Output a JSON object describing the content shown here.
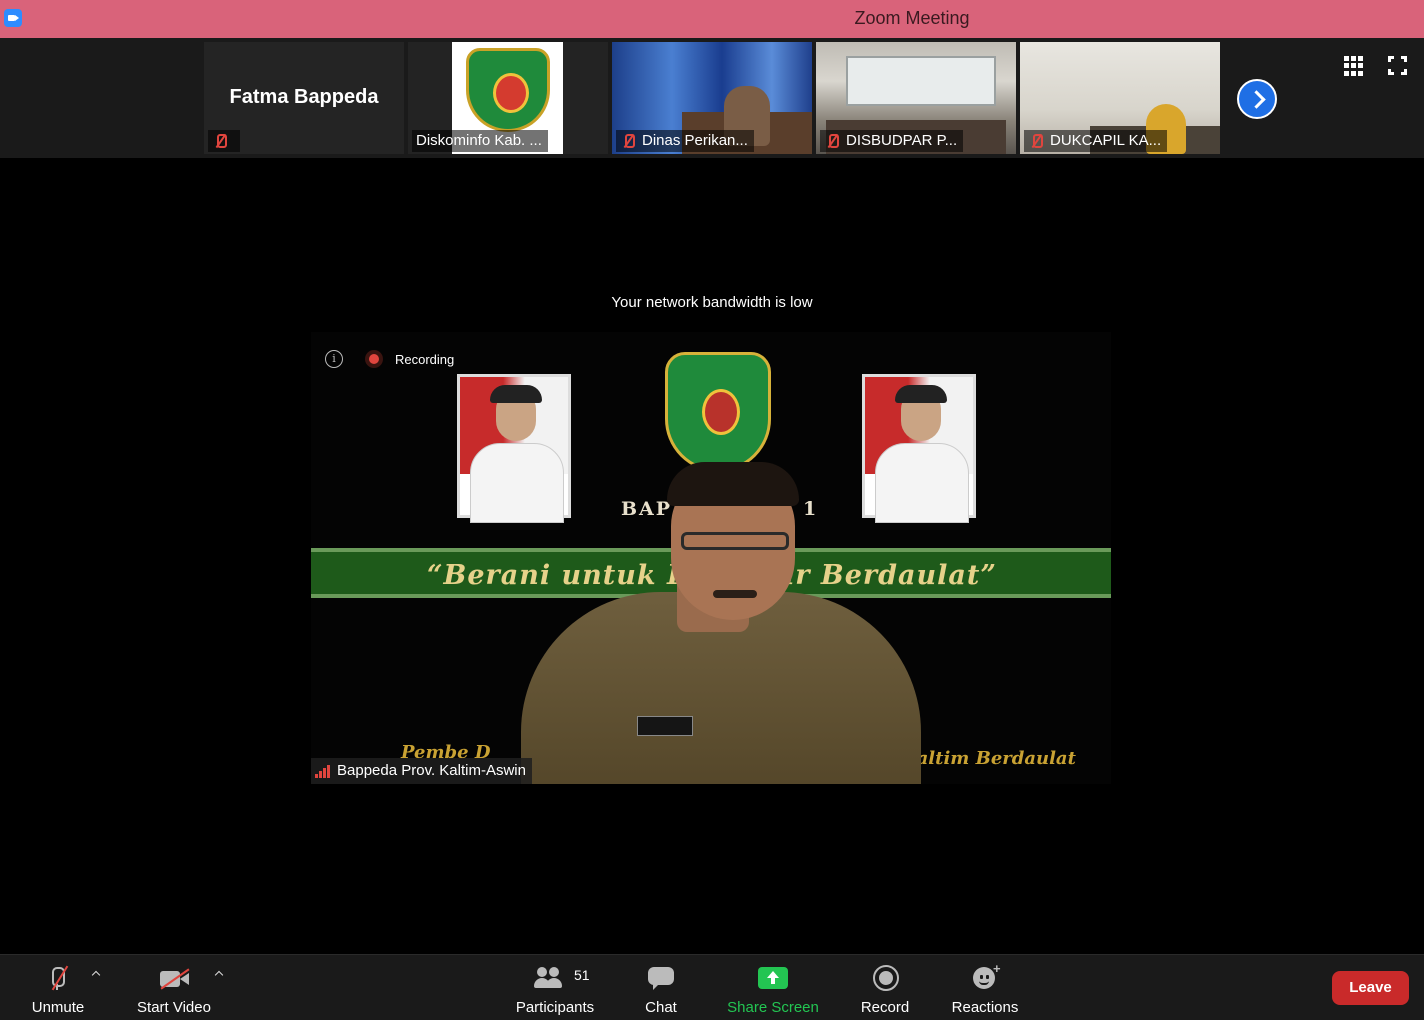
{
  "window": {
    "title": "Zoom Meeting"
  },
  "participants_strip": {
    "tiles": [
      {
        "name": "Fatma Bappeda",
        "muted": true,
        "video": false
      },
      {
        "name": "Diskominfo Kab. ...",
        "muted": false,
        "video": true
      },
      {
        "name": "Dinas Perikan...",
        "muted": true,
        "video": true
      },
      {
        "name": "DISBUDPAR P...",
        "muted": true,
        "video": true
      },
      {
        "name": "DUKCAPIL KA...",
        "muted": true,
        "video": true
      }
    ],
    "next_icon": "chevron-right-icon",
    "gallery_icon": "grid-view-icon",
    "fullscreen_icon": "fullscreen-icon"
  },
  "main": {
    "bandwidth_warning": "Your network bandwidth is low",
    "recording_label": "Recording",
    "speaker_name": "Bappeda Prov. Kaltim-Aswin",
    "slide": {
      "header_text_left": "BAPP",
      "header_text_right": "1",
      "banner_text": "“Berani untuk Kalt      mur Berdaulat”",
      "footer_text_left": "Pembe D",
      "footer_text_right": "Kaltim Berdaulat"
    }
  },
  "toolbar": {
    "unmute_label": "Unmute",
    "start_video_label": "Start Video",
    "participants_label": "Participants",
    "participants_count": "51",
    "chat_label": "Chat",
    "share_screen_label": "Share Screen",
    "record_label": "Record",
    "reactions_label": "Reactions",
    "leave_label": "Leave"
  },
  "colors": {
    "title_bar": "#d9637a",
    "share_green": "#23c552",
    "leave_red": "#c92a2a",
    "accent_blue": "#1f6fe5"
  }
}
